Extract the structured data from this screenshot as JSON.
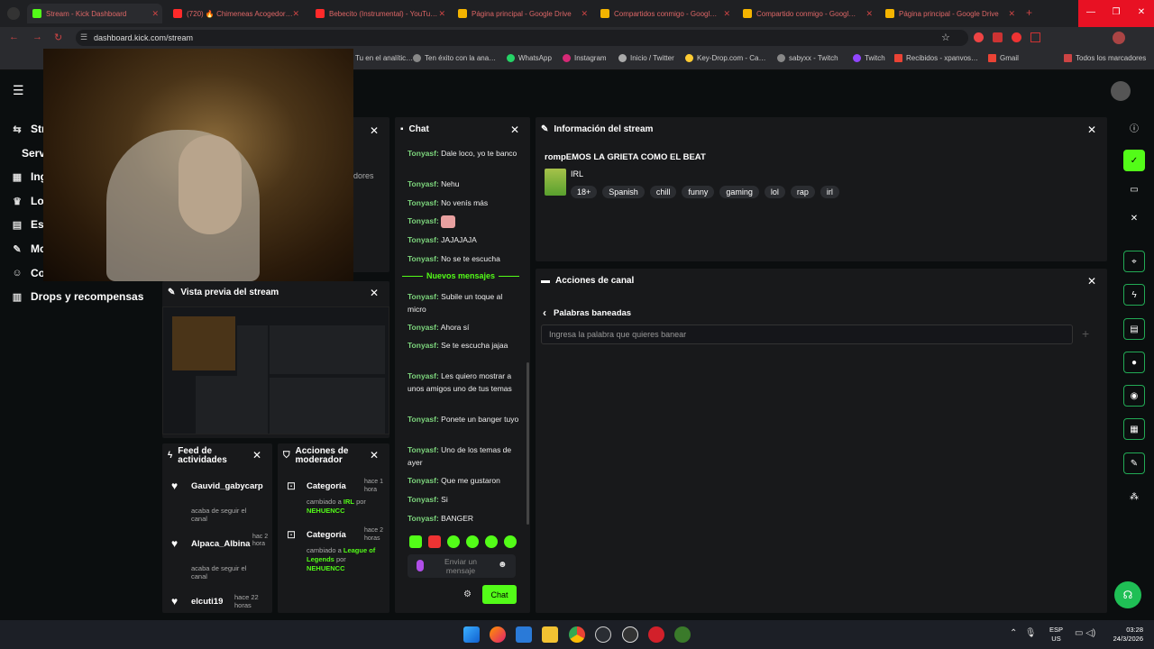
{
  "browser": {
    "tabs": [
      {
        "label": "Stream - Kick Dashboard",
        "color": "#53fc18"
      },
      {
        "label": "(720) 🔥 Chimeneas Acogedor…",
        "color": "#ff2a2a"
      },
      {
        "label": "Bebecito (Instrumental) - YouTu…",
        "color": "#ff2a2a"
      },
      {
        "label": "Página principal - Google Drive",
        "color": "#f4b400"
      },
      {
        "label": "Compartidos conmigo - Googl…",
        "color": "#f4b400"
      },
      {
        "label": "Compartido conmigo - Googl…",
        "color": "#f4b400"
      },
      {
        "label": "Página principal - Google Drive",
        "color": "#f4b400"
      }
    ],
    "url": "dashboard.kick.com/stream",
    "bookmarks": [
      {
        "label": "Tu en el analític…"
      },
      {
        "label": "Ten éxito con la ana…"
      },
      {
        "label": "WhatsApp"
      },
      {
        "label": "Instagram"
      },
      {
        "label": "Inicio / Twitter"
      },
      {
        "label": "Key-Drop.com - Ca…"
      },
      {
        "label": "sabyxx - Twitch"
      },
      {
        "label": "Twitch"
      },
      {
        "label": "Recibidos - xpanvos…"
      },
      {
        "label": "Gmail"
      }
    ],
    "bookmarks_folder": "Todos los marcadores"
  },
  "sidebar": {
    "items": [
      {
        "icon": "broadcast-icon",
        "label": "Str"
      },
      {
        "icon": "",
        "label": "Serv"
      },
      {
        "icon": "chart-icon",
        "label": "Ing"
      },
      {
        "icon": "trophy-icon",
        "label": "Loc"
      },
      {
        "icon": "stats-icon",
        "label": "Est"
      },
      {
        "icon": "wrench-icon",
        "label": "Mo"
      },
      {
        "icon": "people-icon",
        "label": "Co"
      },
      {
        "icon": "gift-icon",
        "label": "Drops y recompensas"
      }
    ]
  },
  "hidden_panel": {
    "partial_text": "dores"
  },
  "preview": {
    "title": "Vista previa del stream"
  },
  "activity_feed": {
    "title": "Feed de actividades",
    "items": [
      {
        "user": "Gauvid_gabycarp",
        "time": "",
        "desc": "acaba de seguir el canal"
      },
      {
        "user": "Alpaca_Albina",
        "time": "hac 2 hora",
        "desc": "acaba de seguir el canal"
      },
      {
        "user": "elcuti19",
        "time": "hace 22 horas",
        "desc": ""
      }
    ]
  },
  "mod_actions": {
    "title": "Acciones de moderador",
    "items": [
      {
        "title": "Categoría",
        "time": "hace 1 hora",
        "changed": "cambiado a",
        "value": "IRL",
        "by": "por",
        "user": "NEHUENCC"
      },
      {
        "title": "Categoría",
        "time": "hace 2 horas",
        "changed": "cambiado a",
        "value": "League of Legends",
        "by": "por",
        "user": "NEHUENCC"
      }
    ]
  },
  "chat": {
    "title": "Chat",
    "messages": [
      {
        "user": "Tonyasf:",
        "text": "Dale loco, yo te banco"
      },
      {
        "user": "Tonyasf:",
        "text": "Nehu"
      },
      {
        "user": "Tonyasf:",
        "text": "No venís más"
      },
      {
        "user": "Tonyasf:",
        "text": ""
      },
      {
        "user": "Tonyasf:",
        "text": "JAJAJAJA"
      },
      {
        "user": "Tonyasf:",
        "text": "No se te escucha"
      },
      {
        "user": "Tonyasf:",
        "text": "Subile un toque al micro"
      },
      {
        "user": "Tonyasf:",
        "text": "Ahora sí"
      },
      {
        "user": "Tonyasf:",
        "text": "Se te escucha jajaa"
      },
      {
        "user": "Tonyasf:",
        "text": "Les quiero mostrar a unos amigos uno de tus temas"
      },
      {
        "user": "Tonyasf:",
        "text": "Ponete un banger tuyo"
      },
      {
        "user": "Tonyasf:",
        "text": "Uno de los temas de ayer"
      },
      {
        "user": "Tonyasf:",
        "text": "Que me gustaron"
      },
      {
        "user": "Tonyasf:",
        "text": "Si"
      },
      {
        "user": "Tonyasf:",
        "text": "BANGER"
      }
    ],
    "new_messages": "Nuevos mensajes",
    "input_placeholder": "Enviar un mensaje",
    "send_label": "Chat"
  },
  "stream_info": {
    "title": "Información del stream",
    "stream_title": "rompEMOS LA GRIETA COMO EL BEAT",
    "category": "IRL",
    "tags": [
      "18+",
      "Spanish",
      "chill",
      "funny",
      "gaming",
      "lol",
      "rap",
      "irl"
    ]
  },
  "channel_actions": {
    "title": "Acciones de canal",
    "sub_title": "Palabras baneadas",
    "input_placeholder": "Ingresa la palabra que quieres banear"
  },
  "taskbar": {
    "lang": "ESP",
    "region": "US",
    "time": "03:28",
    "date": "24/3/2026"
  },
  "colors": {
    "accent": "#53fc18",
    "panel": "#18191b",
    "bg": "#0b0e0f"
  }
}
